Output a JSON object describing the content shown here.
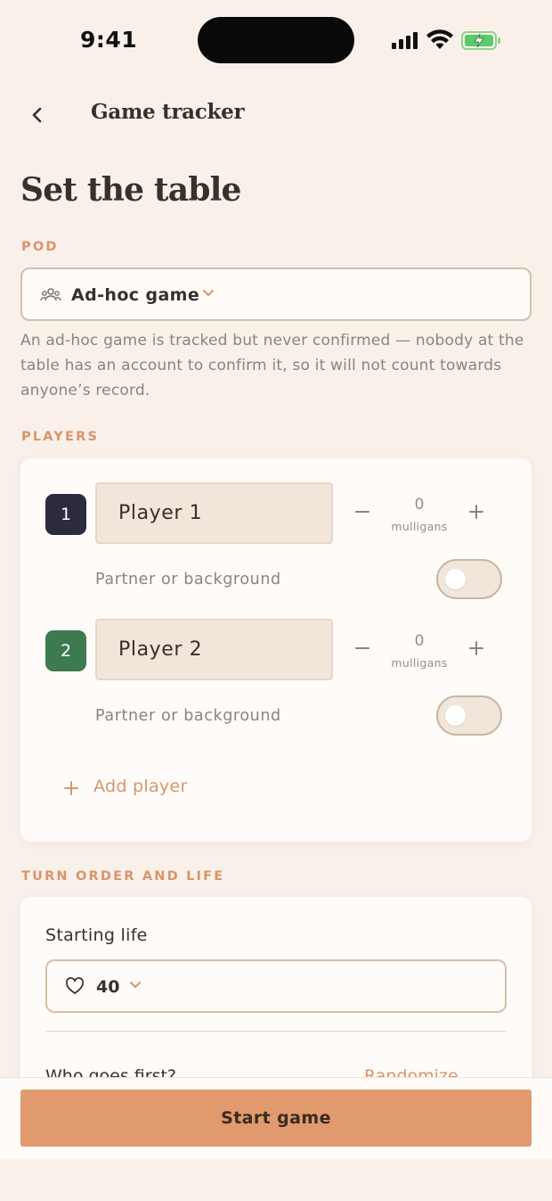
{
  "status_bar": {
    "time": "9:41"
  },
  "nav": {
    "title": "Game tracker"
  },
  "page": {
    "title": "Set the table"
  },
  "pod": {
    "section_label": "POD",
    "selected": "Ad-hoc game",
    "help_text": "An ad-hoc game is tracked but never confirmed — nobody at the table has an account to confirm it, so it will not count towards anyone’s record."
  },
  "players": {
    "section_label": "PLAYERS",
    "items": [
      {
        "number": "1",
        "name": "Player 1",
        "badge_color": "#2b2a3e",
        "mulligans": "0",
        "mulligans_label": "mulligans",
        "partner_label": "Partner or background",
        "partner_enabled": false
      },
      {
        "number": "2",
        "name": "Player 2",
        "badge_color": "#3e7a4f",
        "mulligans": "0",
        "mulligans_label": "mulligans",
        "partner_label": "Partner or background",
        "partner_enabled": false
      }
    ],
    "add_label": "Add player"
  },
  "turn_order": {
    "section_label": "TURN ORDER AND LIFE",
    "starting_life_label": "Starting life",
    "starting_life_value": "40",
    "who_first_label": "Who goes first?",
    "randomize_label": "Randomize"
  },
  "footer": {
    "start_label": "Start game"
  },
  "colors": {
    "accent": "#e09a6e",
    "label_accent": "#d9956a",
    "background": "#f9f0ea",
    "card": "#fefbf9"
  }
}
